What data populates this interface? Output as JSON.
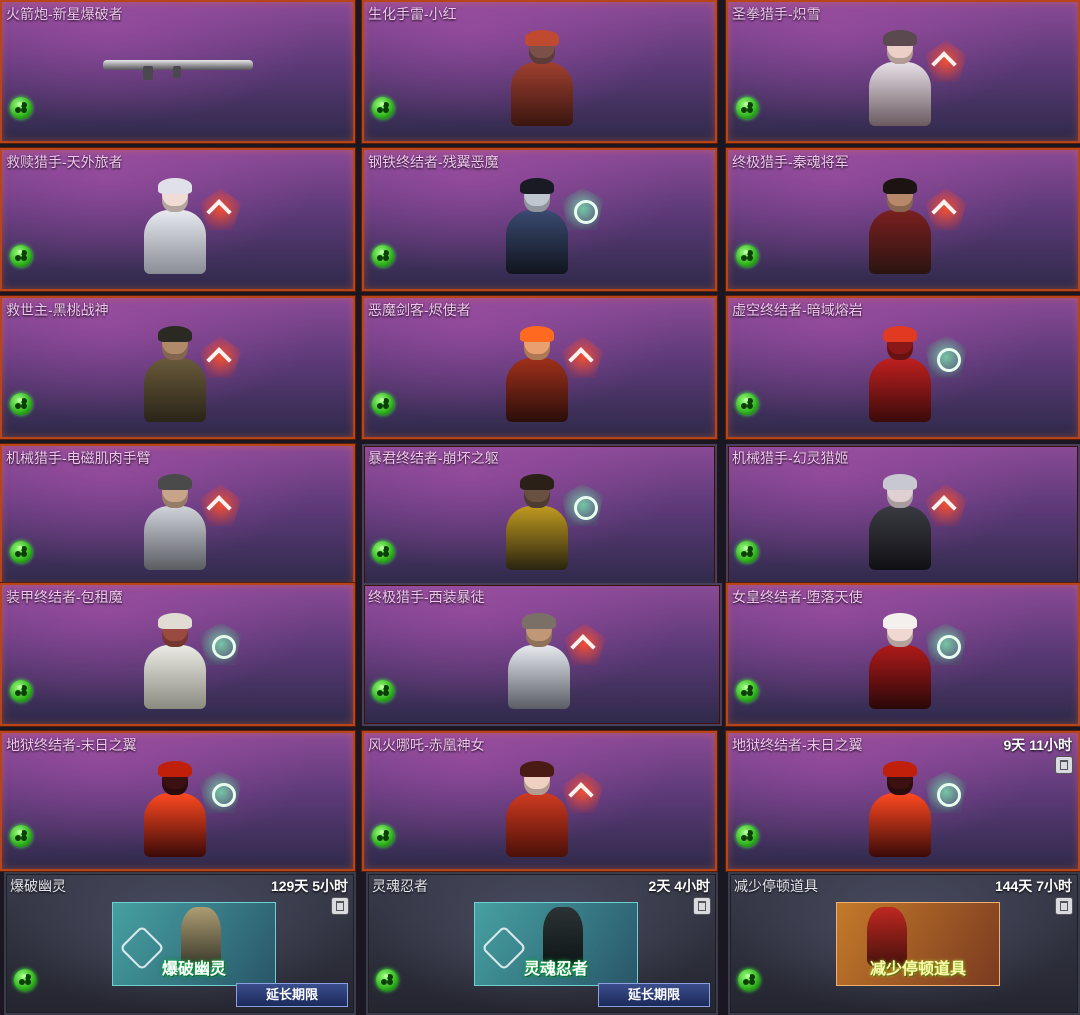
{
  "inventory": {
    "items": [
      {
        "name": "火箭炮-新星爆破者",
        "type": "weapon"
      },
      {
        "name": "生化手雷-小红",
        "type": "character"
      },
      {
        "name": "圣拳猎手-炽雪",
        "type": "character",
        "emblem": "red"
      },
      {
        "name": "救赎猎手-天外旅者",
        "type": "character",
        "emblem": "red"
      },
      {
        "name": "钢铁终结者-残翼恶魔",
        "type": "character",
        "emblem": "green"
      },
      {
        "name": "终极猎手-秦魂将军",
        "type": "character",
        "emblem": "red"
      },
      {
        "name": "救世主-黑桃战神",
        "type": "character",
        "emblem": "red"
      },
      {
        "name": "恶魔剑客-烬使者",
        "type": "character",
        "emblem": "red"
      },
      {
        "name": "虚空终结者-暗域熔岩",
        "type": "character",
        "emblem": "green"
      },
      {
        "name": "机械猎手-电磁肌肉手臂",
        "type": "character",
        "emblem": "red"
      },
      {
        "name": "暴君终结者-崩坏之躯",
        "type": "character",
        "emblem": "green"
      },
      {
        "name": "机械猎手-幻灵猎姬",
        "type": "character",
        "emblem": "red"
      },
      {
        "name": "装甲终结者-包租魔",
        "type": "character",
        "emblem": "green"
      },
      {
        "name": "终极猎手-西装暴徒",
        "type": "character",
        "emblem": "red"
      },
      {
        "name": "女皇终结者-堕落天使",
        "type": "character",
        "emblem": "green"
      },
      {
        "name": "地狱终结者-末日之翼",
        "type": "character",
        "emblem": "green"
      },
      {
        "name": "风火哪吒-赤凰神女",
        "type": "character",
        "emblem": "red"
      },
      {
        "name": "地狱终结者-末日之翼",
        "type": "character",
        "emblem": "green",
        "timer": "9天 11小时"
      }
    ],
    "timed_items": [
      {
        "name": "爆破幽灵",
        "timer": "129天 5小时",
        "banner_text": "爆破幽灵",
        "button": "延长期限"
      },
      {
        "name": "灵魂忍者",
        "timer": "2天 4小时",
        "banner_text": "灵魂忍者",
        "button": "延长期限"
      },
      {
        "name": "减少停顿道具",
        "timer": "144天 7小时",
        "banner_text": "减少停顿道具"
      }
    ]
  },
  "icons": {
    "team": "team-icon",
    "delete": "trash-icon",
    "emblem_red": "red-rank-emblem-icon",
    "emblem_green": "green-rank-emblem-icon"
  },
  "colors": {
    "card_border": "#b8441a",
    "name_text": "#f3c7f0",
    "button_bg": "#2c3c74",
    "team_icon": "#2fb21c"
  }
}
